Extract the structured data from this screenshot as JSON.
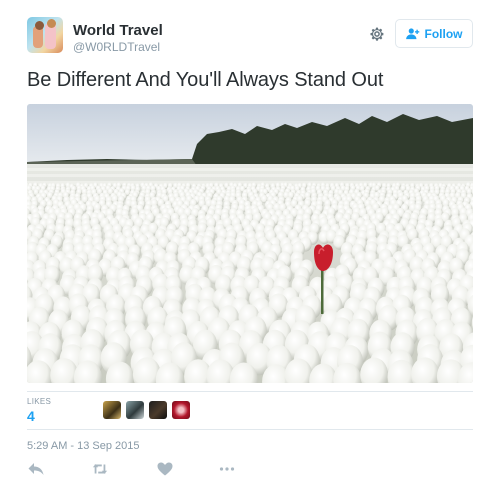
{
  "user": {
    "name": "World Travel",
    "handle": "@W0RLDTravel"
  },
  "header": {
    "follow_label": "Follow"
  },
  "tweet": {
    "text": "Be Different And You'll Always Stand Out",
    "likes_label": "LIKES",
    "likes_count": "4",
    "timestamp": "5:29 AM - 13 Sep 2015"
  },
  "colors": {
    "accent": "#1da1f2",
    "muted": "#8899a6",
    "text": "#292f33",
    "divider": "#e1e8ed",
    "tulip_red": "#c81e2c"
  },
  "icons": {
    "settings": "gear-icon",
    "follow": "add-person-icon",
    "reply": "reply-icon",
    "retweet": "retweet-icon",
    "like": "heart-icon",
    "more": "more-dots-icon"
  }
}
